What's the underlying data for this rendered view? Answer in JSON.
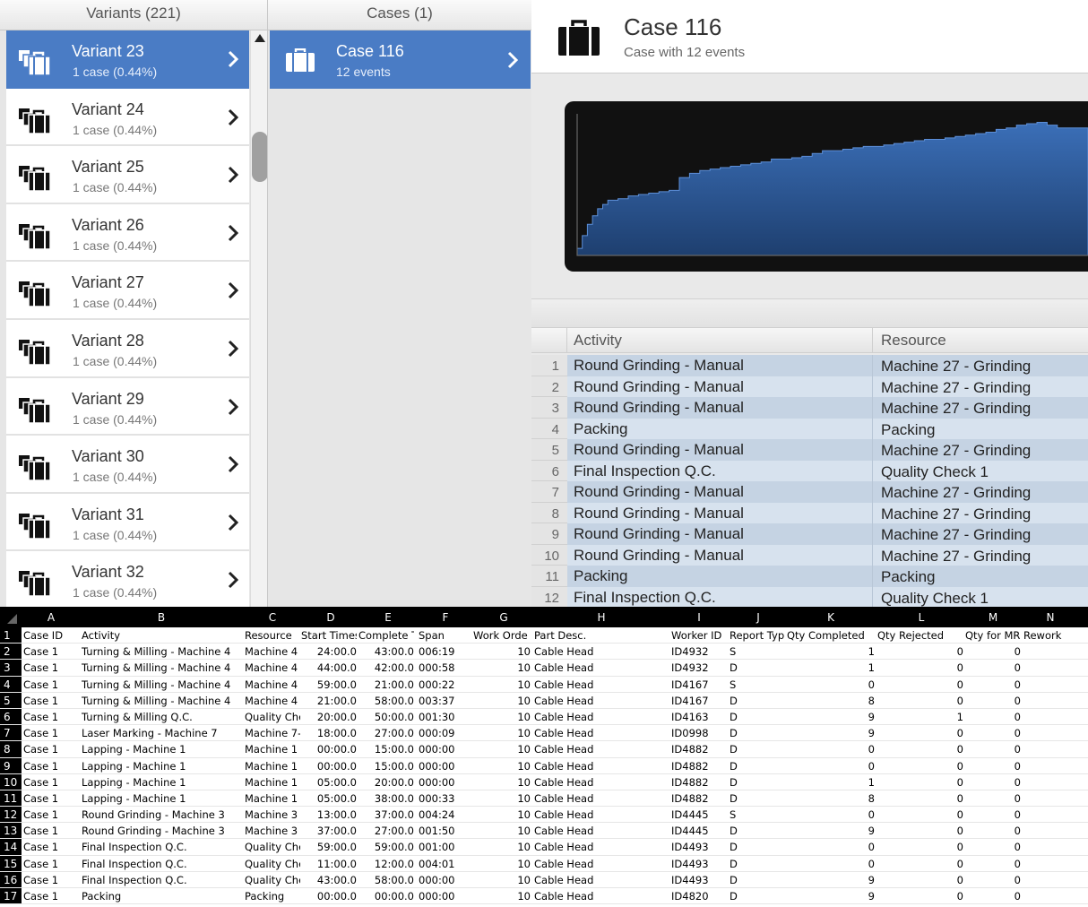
{
  "colors": {
    "accent": "#4a7cc5",
    "chart_fill": "#2b5aa0",
    "chart_bg": "#111111"
  },
  "icons": {
    "list": "briefcase-stack-icon",
    "case": "briefcase-icon",
    "nav": "chevron-right-icon"
  },
  "variants": {
    "header": "Variants (221)",
    "items": [
      {
        "name": "Variant 23",
        "sub": "1 case (0.44%)",
        "selected": true
      },
      {
        "name": "Variant 24",
        "sub": "1 case (0.44%)",
        "selected": false
      },
      {
        "name": "Variant 25",
        "sub": "1 case (0.44%)",
        "selected": false
      },
      {
        "name": "Variant 26",
        "sub": "1 case (0.44%)",
        "selected": false
      },
      {
        "name": "Variant 27",
        "sub": "1 case (0.44%)",
        "selected": false
      },
      {
        "name": "Variant 28",
        "sub": "1 case (0.44%)",
        "selected": false
      },
      {
        "name": "Variant 29",
        "sub": "1 case (0.44%)",
        "selected": false
      },
      {
        "name": "Variant 30",
        "sub": "1 case (0.44%)",
        "selected": false
      },
      {
        "name": "Variant 31",
        "sub": "1 case (0.44%)",
        "selected": false
      },
      {
        "name": "Variant 32",
        "sub": "1 case (0.44%)",
        "selected": false
      }
    ]
  },
  "cases": {
    "header": "Cases (1)",
    "items": [
      {
        "name": "Case 116",
        "sub": "12 events",
        "selected": true
      }
    ]
  },
  "detail": {
    "title": "Case 116",
    "subtitle": "Case with 12 events",
    "chart": {
      "type": "area",
      "points": [
        [
          0.0,
          0.05
        ],
        [
          0.01,
          0.14
        ],
        [
          0.02,
          0.22
        ],
        [
          0.03,
          0.28
        ],
        [
          0.04,
          0.33
        ],
        [
          0.05,
          0.36
        ],
        [
          0.06,
          0.39
        ],
        [
          0.08,
          0.4
        ],
        [
          0.1,
          0.42
        ],
        [
          0.12,
          0.43
        ],
        [
          0.14,
          0.44
        ],
        [
          0.16,
          0.45
        ],
        [
          0.18,
          0.46
        ],
        [
          0.2,
          0.55
        ],
        [
          0.22,
          0.58
        ],
        [
          0.24,
          0.6
        ],
        [
          0.26,
          0.61
        ],
        [
          0.28,
          0.62
        ],
        [
          0.3,
          0.63
        ],
        [
          0.32,
          0.64
        ],
        [
          0.34,
          0.65
        ],
        [
          0.36,
          0.66
        ],
        [
          0.38,
          0.68
        ],
        [
          0.4,
          0.68
        ],
        [
          0.42,
          0.69
        ],
        [
          0.44,
          0.7
        ],
        [
          0.46,
          0.72
        ],
        [
          0.48,
          0.74
        ],
        [
          0.5,
          0.74
        ],
        [
          0.52,
          0.75
        ],
        [
          0.54,
          0.76
        ],
        [
          0.56,
          0.77
        ],
        [
          0.58,
          0.77
        ],
        [
          0.6,
          0.78
        ],
        [
          0.62,
          0.79
        ],
        [
          0.64,
          0.8
        ],
        [
          0.66,
          0.81
        ],
        [
          0.68,
          0.82
        ],
        [
          0.7,
          0.82
        ],
        [
          0.72,
          0.83
        ],
        [
          0.74,
          0.84
        ],
        [
          0.76,
          0.85
        ],
        [
          0.78,
          0.86
        ],
        [
          0.8,
          0.87
        ],
        [
          0.82,
          0.89
        ],
        [
          0.84,
          0.9
        ],
        [
          0.86,
          0.92
        ],
        [
          0.88,
          0.93
        ],
        [
          0.9,
          0.94
        ],
        [
          0.92,
          0.92
        ],
        [
          0.94,
          0.9
        ],
        [
          0.96,
          0.9
        ],
        [
          1.0,
          0.9
        ]
      ]
    },
    "events": {
      "columns": [
        "Activity",
        "Resource"
      ],
      "rows": [
        {
          "n": "1",
          "activity": "Round Grinding - Manual",
          "resource": "Machine 27 - Grinding"
        },
        {
          "n": "2",
          "activity": "Round Grinding - Manual",
          "resource": "Machine 27 - Grinding"
        },
        {
          "n": "3",
          "activity": "Round Grinding - Manual",
          "resource": "Machine 27 - Grinding"
        },
        {
          "n": "4",
          "activity": "Packing",
          "resource": "Packing"
        },
        {
          "n": "5",
          "activity": "Round Grinding - Manual",
          "resource": "Machine 27 - Grinding"
        },
        {
          "n": "6",
          "activity": "Final Inspection Q.C.",
          "resource": "Quality Check 1"
        },
        {
          "n": "7",
          "activity": "Round Grinding - Manual",
          "resource": "Machine 27 - Grinding"
        },
        {
          "n": "8",
          "activity": "Round Grinding - Manual",
          "resource": "Machine 27 - Grinding"
        },
        {
          "n": "9",
          "activity": "Round Grinding - Manual",
          "resource": "Machine 27 - Grinding"
        },
        {
          "n": "10",
          "activity": "Round Grinding - Manual",
          "resource": "Machine 27 - Grinding"
        },
        {
          "n": "11",
          "activity": "Packing",
          "resource": "Packing"
        },
        {
          "n": "12",
          "activity": "Final Inspection Q.C.",
          "resource": "Quality Check 1"
        }
      ]
    }
  },
  "sheet": {
    "col_letters": [
      "A",
      "B",
      "C",
      "D",
      "E",
      "F",
      "G",
      "H",
      "I",
      "J",
      "K",
      "L",
      "M",
      "N"
    ],
    "headers": [
      "Case ID",
      "Activity",
      "Resource",
      "Start Times",
      "Complete T",
      "Span",
      "Work Orde",
      "Part Desc.",
      "Worker ID",
      "Report Typ",
      "Qty Completed",
      "Qty Rejected",
      "Qty for MR",
      "Rework"
    ],
    "rows": [
      [
        "Case 1",
        "Turning & Milling - Machine 4",
        "Machine 4",
        "24:00.0",
        "43:00.0",
        "006:19",
        "10",
        "Cable Head",
        "ID4932",
        "S",
        "1",
        "0",
        "0",
        ""
      ],
      [
        "Case 1",
        "Turning & Milling - Machine 4",
        "Machine 4",
        "44:00.0",
        "42:00.0",
        "000:58",
        "10",
        "Cable Head",
        "ID4932",
        "D",
        "1",
        "0",
        "0",
        ""
      ],
      [
        "Case 1",
        "Turning & Milling - Machine 4",
        "Machine 4",
        "59:00.0",
        "21:00.0",
        "000:22",
        "10",
        "Cable Head",
        "ID4167",
        "S",
        "0",
        "0",
        "0",
        ""
      ],
      [
        "Case 1",
        "Turning & Milling - Machine 4",
        "Machine 4",
        "21:00.0",
        "58:00.0",
        "003:37",
        "10",
        "Cable Head",
        "ID4167",
        "D",
        "8",
        "0",
        "0",
        ""
      ],
      [
        "Case 1",
        "Turning & Milling Q.C.",
        "Quality Che",
        "20:00.0",
        "50:00.0",
        "001:30",
        "10",
        "Cable Head",
        "ID4163",
        "D",
        "9",
        "1",
        "0",
        ""
      ],
      [
        "Case 1",
        "Laser Marking - Machine 7",
        "Machine 7-",
        "18:00.0",
        "27:00.0",
        "000:09",
        "10",
        "Cable Head",
        "ID0998",
        "D",
        "9",
        "0",
        "0",
        ""
      ],
      [
        "Case 1",
        "Lapping - Machine 1",
        "Machine 1",
        "00:00.0",
        "15:00.0",
        "000:00",
        "10",
        "Cable Head",
        "ID4882",
        "D",
        "0",
        "0",
        "0",
        ""
      ],
      [
        "Case 1",
        "Lapping - Machine 1",
        "Machine 1",
        "00:00.0",
        "15:00.0",
        "000:00",
        "10",
        "Cable Head",
        "ID4882",
        "D",
        "0",
        "0",
        "0",
        ""
      ],
      [
        "Case 1",
        "Lapping - Machine 1",
        "Machine 1",
        "05:00.0",
        "20:00.0",
        "000:00",
        "10",
        "Cable Head",
        "ID4882",
        "D",
        "1",
        "0",
        "0",
        ""
      ],
      [
        "Case 1",
        "Lapping - Machine 1",
        "Machine 1",
        "05:00.0",
        "38:00.0",
        "000:33",
        "10",
        "Cable Head",
        "ID4882",
        "D",
        "8",
        "0",
        "0",
        ""
      ],
      [
        "Case 1",
        "Round Grinding - Machine 3",
        "Machine 3",
        "13:00.0",
        "37:00.0",
        "004:24",
        "10",
        "Cable Head",
        "ID4445",
        "S",
        "0",
        "0",
        "0",
        ""
      ],
      [
        "Case 1",
        "Round Grinding - Machine 3",
        "Machine 3",
        "37:00.0",
        "27:00.0",
        "001:50",
        "10",
        "Cable Head",
        "ID4445",
        "D",
        "9",
        "0",
        "0",
        ""
      ],
      [
        "Case 1",
        "Final Inspection Q.C.",
        "Quality Che",
        "59:00.0",
        "59:00.0",
        "001:00",
        "10",
        "Cable Head",
        "ID4493",
        "D",
        "0",
        "0",
        "0",
        ""
      ],
      [
        "Case 1",
        "Final Inspection Q.C.",
        "Quality Che",
        "11:00.0",
        "12:00.0",
        "004:01",
        "10",
        "Cable Head",
        "ID4493",
        "D",
        "0",
        "0",
        "0",
        ""
      ],
      [
        "Case 1",
        "Final Inspection Q.C.",
        "Quality Che",
        "43:00.0",
        "58:00.0",
        "000:00",
        "10",
        "Cable Head",
        "ID4493",
        "D",
        "9",
        "0",
        "0",
        ""
      ],
      [
        "Case 1",
        "Packing",
        "Packing",
        "00:00.0",
        "00:00.0",
        "000:00",
        "10",
        "Cable Head",
        "ID4820",
        "D",
        "9",
        "0",
        "0",
        ""
      ]
    ]
  }
}
